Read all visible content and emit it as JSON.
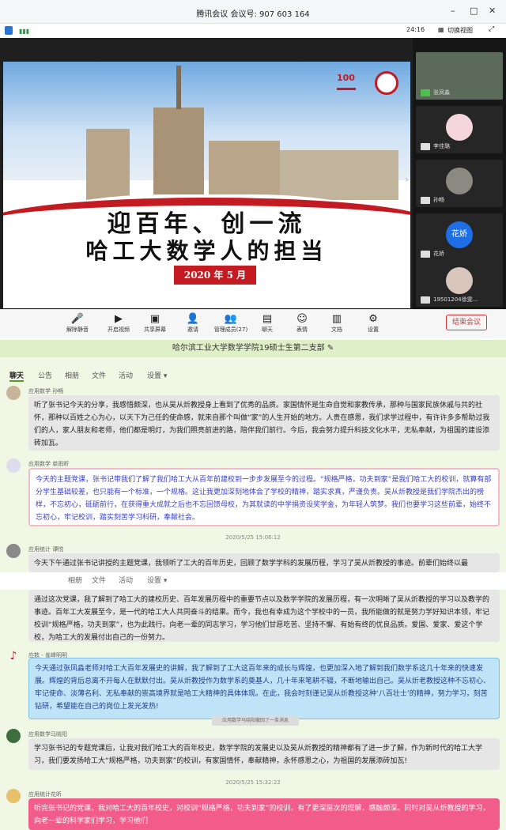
{
  "window": {
    "title": "腾讯会议  会议号: 907 603 164",
    "minimize": "–",
    "maximize": "□",
    "close": "✕"
  },
  "infobar": {
    "clock": "24:16",
    "switch_view": "切换视图"
  },
  "slide": {
    "line1": "迎百年、创一流",
    "line2": "哈工大数学人的担当",
    "date": "2020 年 5 月",
    "page": "1"
  },
  "participants": [
    {
      "name": "张凤淼"
    },
    {
      "name": "李佳璐"
    },
    {
      "name": "孙畅"
    },
    {
      "name": "花娇",
      "initials": "花娇"
    },
    {
      "name": "19501204徐雯..."
    }
  ],
  "toolbar": {
    "items": [
      {
        "label": "解除静音",
        "glyph": "🎤"
      },
      {
        "label": "开启视频",
        "glyph": "▶"
      },
      {
        "label": "共享屏幕",
        "glyph": "▣"
      },
      {
        "label": "邀请",
        "glyph": "👤"
      },
      {
        "label": "管理成员(27)",
        "glyph": "👥"
      },
      {
        "label": "聊天",
        "glyph": "▤"
      },
      {
        "label": "表情",
        "glyph": "☺"
      },
      {
        "label": "文档",
        "glyph": "▥"
      },
      {
        "label": "设置",
        "glyph": "⚙"
      }
    ],
    "end_label": "结束会议"
  },
  "group": {
    "title": "哈尔滨工业大学数学学院19硕士生第二支部 ✎"
  },
  "tabs": [
    "聊天",
    "公告",
    "相册",
    "文件",
    "活动",
    "设置 ▾"
  ],
  "messages": [
    {
      "sender": "应用数学 孙畅",
      "text": "听了张书记今天的分享，我感悟颇深，也从吴从炘教授身上看到了优秀的品质。家国情怀是生命自觉和家教传承，那种与国家民族休戚与共的社怀，那种以百姓之心为心，以天下为己任的使命感，就来自那个叫做“家”的人生开始的地方。人贵在感恩，我们求学过程中，有许许多多帮助过我们的人，家人朋友和老师，他们都是明灯，为我们照亮前进的路，陪伴我们前行。今后，我会努力提升科技文化水平，无私奉献，为祖国的建设添砖加瓦。"
    },
    {
      "sender": "应用数学 单雨昕",
      "text": "今天的主题党课，张书记带我们了解了我们哈工大从百年前建校到一步步发展至今的过程。“规格严格，功夫到家”是我们哈工大的校训，就算有部分学生基础较差，也只能有一个标准，一个规格。这让我更加深刻地体会了学校的精神，踏实求真，严谨负责。吴从炘教授是我们学院杰出的榜样，不忘初心，砥砺前行，在获得重大成就之后也不忘回馈母校，为其就读的中学捐资设奖学金，为年轻人筑梦。我们也要学习这些前辈，始终不忘初心，牢记校训，踏实刻苦学习科研，奉献社会。"
    },
    {
      "sender": "应用统计 谭悦",
      "text": "今天下午通过张书记讲授的主题党课，我领听了工大的百年历史，回顾了数学学科的发展历程，学习了吴从炘教授的事迹。前辈们始终以最"
    },
    {
      "sender": "",
      "text": "通过这次党课，我了解到了哈工大的建校历史、百年发展历程中的重要节点以及数学学院的发展历程，有一次明晰了吴从炘教授的学习以及教学的事迹。百年工大发展至今，是一代的哈工大人共同奋斗的结果。而今，我也有幸成为这个学校中的一员，我所能做的就是努力学好知识本领，牢记校训“规格严格，功夫到家”，也为此践行。向老一辈的同志学习，学习他们甘愿吃苦、坚持不懈、有始有终的优良品质。爱国、爱家、爱这个学校，为哈工大的发展付出自己的一份努力。"
    },
    {
      "sender": "应数 - 雀峰明明",
      "text": "今天通过张凤淼老师对哈工大百年发展史的讲解，我了解到了工大这百年来的成长与辉煌，也更加深入地了解到我们数学系这几十年来的快速发展。辉煌的背后总离不开每人在默默付出。吴从炘教授作为数学系的奠基人，几十年来笔耕不辍，不断地输出自己。吴从炘老教授这种不忘初心、牢记使命、淡薄名利、无私奉献的崇高境界就是哈工大精神的具体体现。在此，我会时刻谨记吴从炘教授这种‘八百壮士’的精神，努力学习，刻苦钻研，希望能在自己的岗位上发光发热!"
    },
    {
      "sender": "应用数学马晓阳",
      "text": "学习张书记的专题党课后，让我对我们哈工大的百年校史，数学学院的发展史以及吴从炘教授的精神都有了进一步了解，作为新时代的哈工大学习，我们要发扬哈工大“规格严格，功夫到家”的校训，有家国情怀，奉献精神，永怀感恩之心，为祖国的发展添砖加瓦!"
    },
    {
      "sender": "应用统计花昕",
      "text": "听完张书记的党课，我对哈工大的百年校史，对校训“规格严格，功夫到家”的校训，有了更深层次的理解，感触颇深。同时对吴从炘教授的学习，向老一辈的科学家们学习，学习他们"
    }
  ],
  "timestamps": [
    "2020/5/25 15:06:12",
    "2020/5/25 15:32:22"
  ],
  "notice": "应用数学马晓阳撤回了一条消息",
  "repeat_tabs": [
    "相册",
    "文件",
    "活动",
    "设置 ▾"
  ]
}
